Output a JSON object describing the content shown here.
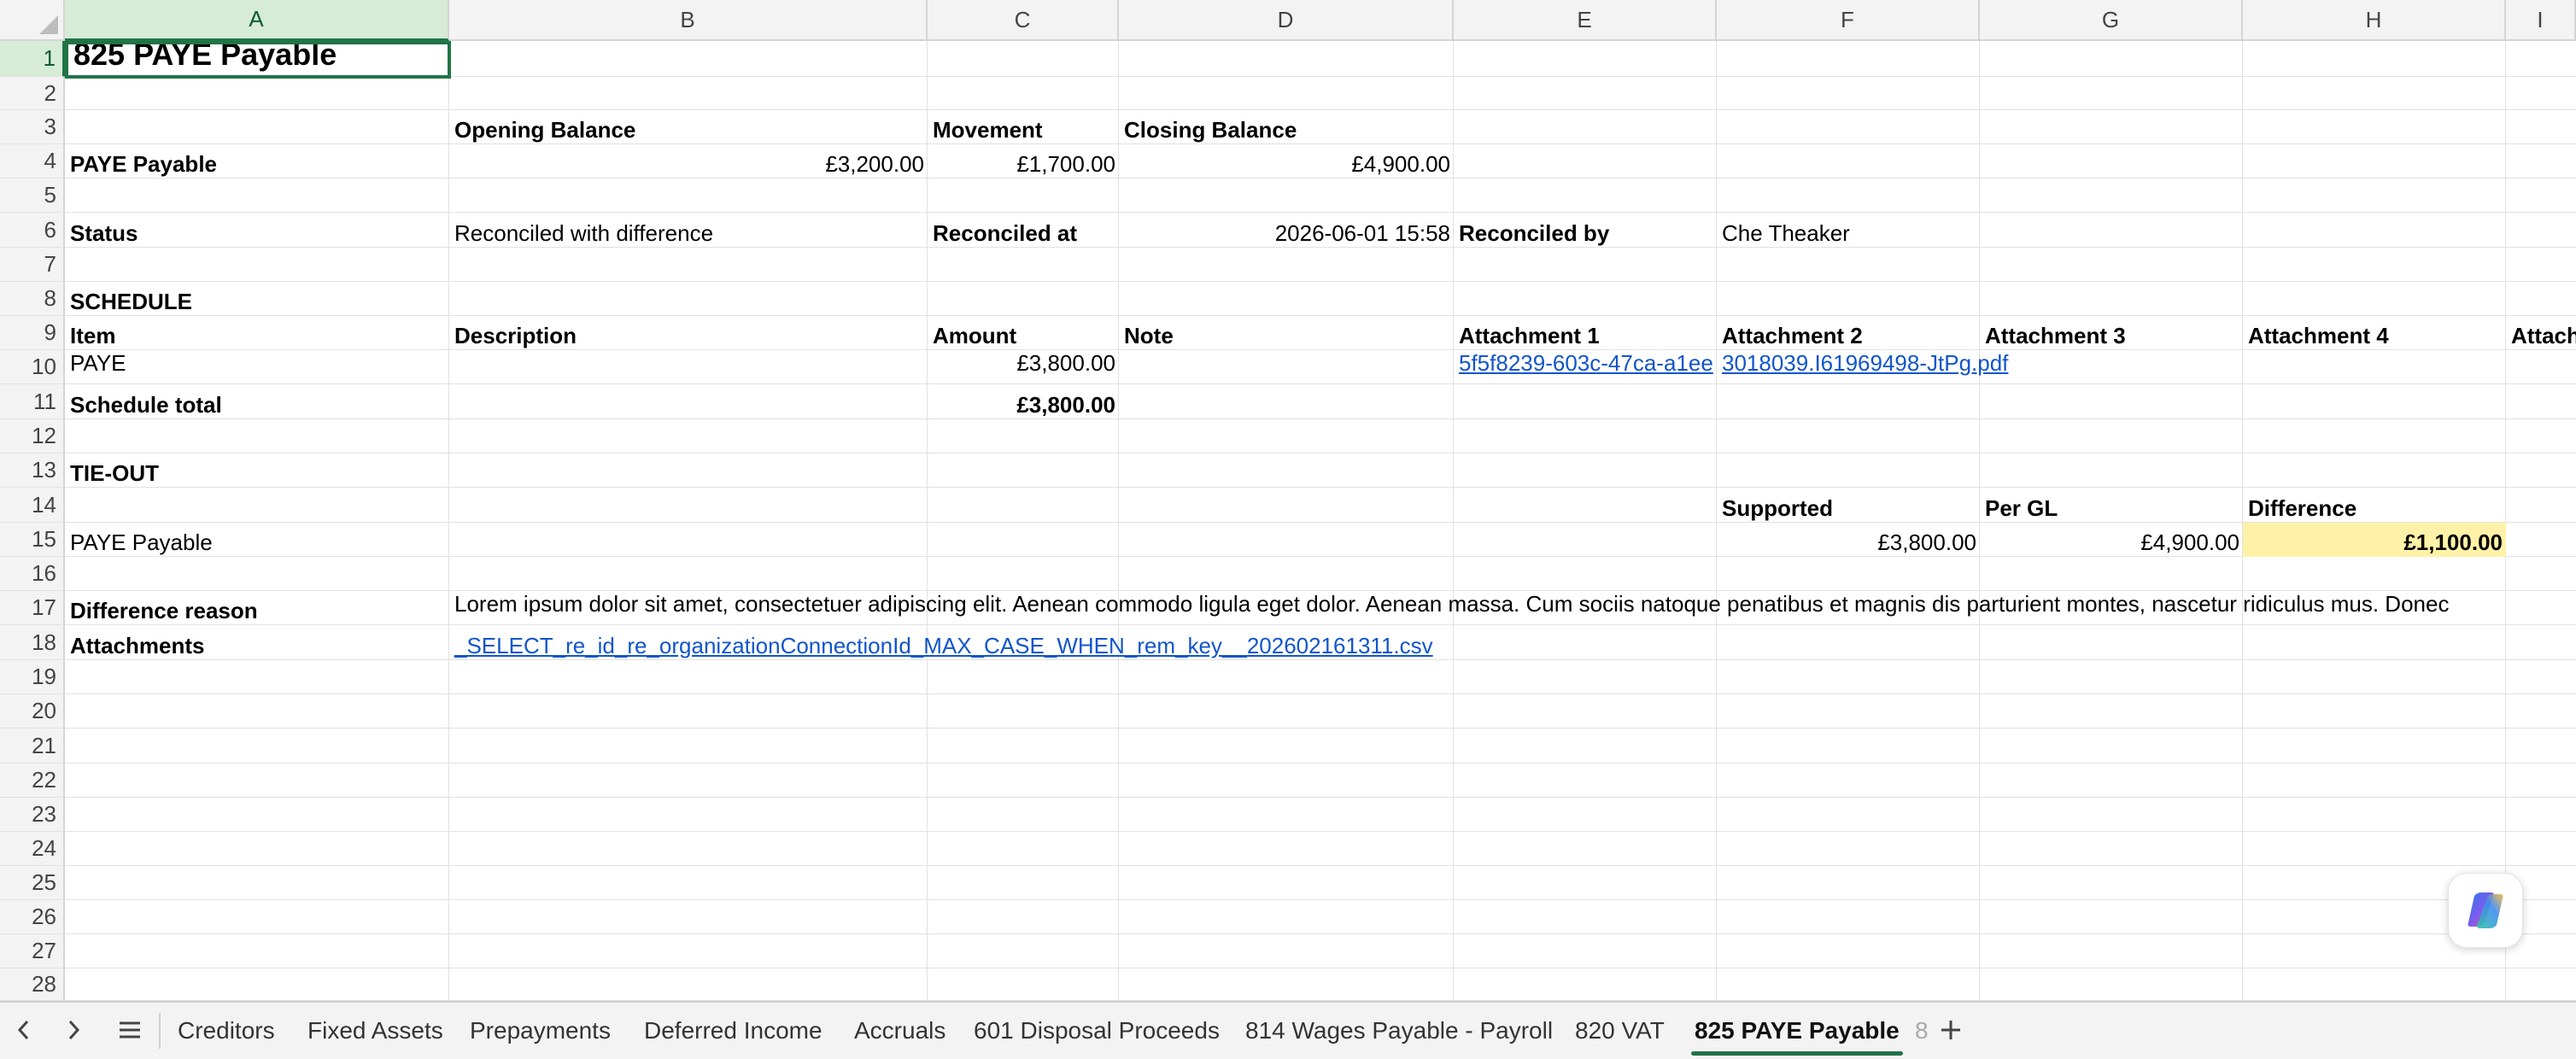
{
  "columns": [
    "A",
    "B",
    "C",
    "D",
    "E",
    "F",
    "G",
    "H",
    "I"
  ],
  "rows": [
    "1",
    "2",
    "3",
    "4",
    "5",
    "6",
    "7",
    "8",
    "9",
    "10",
    "11",
    "12",
    "13",
    "14",
    "15",
    "16",
    "17",
    "18",
    "19",
    "20",
    "21",
    "22",
    "23",
    "24",
    "25",
    "26",
    "27",
    "28"
  ],
  "sheet": {
    "title": "825 PAYE Payable",
    "summary": {
      "opening_label": "Opening Balance",
      "movement_label": "Movement",
      "closing_label": "Closing Balance",
      "row_label": "PAYE Payable",
      "opening": "£3,200.00",
      "movement": "£1,700.00",
      "closing": "£4,900.00"
    },
    "status": {
      "label": "Status",
      "value": "Reconciled with difference",
      "reconciled_at_label": "Reconciled at",
      "reconciled_at": "2026-06-01 15:58",
      "reconciled_by_label": "Reconciled by",
      "reconciled_by": "Che Theaker"
    },
    "schedule": {
      "heading": "SCHEDULE",
      "headers": {
        "item": "Item",
        "description": "Description",
        "amount": "Amount",
        "note": "Note",
        "att1": "Attachment 1",
        "att2": "Attachment 2",
        "att3": "Attachment 3",
        "att4": "Attachment 4",
        "att5": "Attachm"
      },
      "row": {
        "item": "PAYE",
        "amount": "£3,800.00",
        "att1": "5f5f8239-603c-47ca-a1ee",
        "att2": "3018039.I61969498-JtPg.pdf"
      },
      "total_label": "Schedule total",
      "total": "£3,800.00"
    },
    "tieout": {
      "heading": "TIE-OUT",
      "supported_label": "Supported",
      "pergl_label": "Per GL",
      "difference_label": "Difference",
      "row_label": "PAYE Payable",
      "supported": "£3,800.00",
      "pergl": "£4,900.00",
      "difference": "£1,100.00",
      "highlight_color": "#fff2a8"
    },
    "difference_reason": {
      "label": "Difference reason",
      "text": "Lorem ipsum dolor sit amet, consectetuer adipiscing elit. Aenean commodo ligula eget dolor. Aenean massa. Cum sociis natoque penatibus et magnis dis parturient montes, nascetur ridiculus mus. Donec"
    },
    "attachments": {
      "label": "Attachments",
      "file": "_SELECT_re_id_re_organizationConnectionId_MAX_CASE_WHEN_rem_key__202602161311.csv"
    }
  },
  "tabs": [
    {
      "label": "Creditors"
    },
    {
      "label": "Fixed Assets"
    },
    {
      "label": "Prepayments"
    },
    {
      "label": "Deferred Income"
    },
    {
      "label": "Accruals"
    },
    {
      "label": "601 Disposal Proceeds"
    },
    {
      "label": "814 Wages Payable - Payroll"
    },
    {
      "label": "820 VAT"
    },
    {
      "label": "825 PAYE Payable",
      "active": true
    },
    {
      "label": "8"
    }
  ],
  "accent_color": "#217346",
  "link_color": "#1155cc",
  "icons": {
    "prev": "chevron-left-icon",
    "next": "chevron-right-icon",
    "menu": "hamburger-icon",
    "add": "plus-icon",
    "copilot": "copilot-icon"
  }
}
